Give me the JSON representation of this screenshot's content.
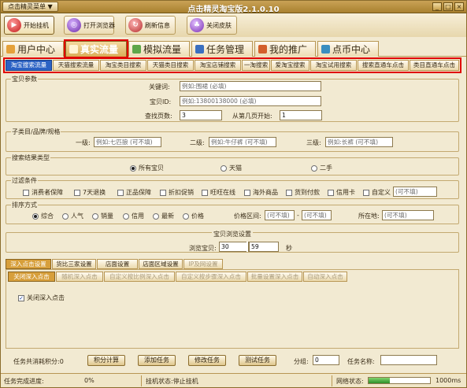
{
  "window": {
    "title": "点击精灵淘宝版2.1.0.10",
    "menu_label": "点击精灵菜单 ▼",
    "min_glyph": "_",
    "max_glyph": "□",
    "close_glyph": "×"
  },
  "toolbar": {
    "buttons": [
      {
        "label": "开始挂机"
      },
      {
        "label": "打开浏览器"
      },
      {
        "label": "刷新信息"
      },
      {
        "label": "关闭皮肤"
      }
    ]
  },
  "main_tabs": [
    {
      "label": "用户中心"
    },
    {
      "label": "真实流量"
    },
    {
      "label": "模拟流量"
    },
    {
      "label": "任务管理"
    },
    {
      "label": "我的推广"
    },
    {
      "label": "点币中心"
    }
  ],
  "sub_tabs": [
    {
      "label": "淘宝搜索流量"
    },
    {
      "label": "天猫搜索流量"
    },
    {
      "label": "淘宝类目搜索"
    },
    {
      "label": "天猫类目搜索"
    },
    {
      "label": "淘宝店铺搜索"
    },
    {
      "label": "一淘搜索"
    },
    {
      "label": "爱淘宝搜索"
    },
    {
      "label": "淘宝试用搜索"
    },
    {
      "label": "搜索直通车点击"
    },
    {
      "label": "类目直通车点击"
    }
  ],
  "basic": {
    "group_label": "宝贝参数",
    "keyword_label": "关键词:",
    "keyword_placeholder": "例如:围裙 (必填)",
    "itemid_label": "宝贝ID:",
    "itemid_placeholder": "例如:13800138000 (必填)",
    "pages_label": "查找页数:",
    "pages_value": "3",
    "start_label": "从第几页开始:",
    "start_value": "1"
  },
  "category": {
    "group_label": "子类目/品牌/规格",
    "level1_label": "一级:",
    "level1_placeholder": "例如:七匹狼 (可不填)",
    "level2_label": "二级:",
    "level2_placeholder": "例如:牛仔裤 (可不填)",
    "level3_label": "三级:",
    "level3_placeholder": "例如:长裤 (可不填)"
  },
  "result_type": {
    "group_label": "搜索结果类型",
    "options": [
      "所有宝贝",
      "天猫",
      "二手"
    ],
    "selected": "所有宝贝"
  },
  "filters": {
    "group_label": "过滤条件",
    "options": [
      "消费者保障",
      "7天退换",
      "正品保障",
      "折扣促销",
      "旺旺在线",
      "海外商品",
      "货到付款",
      "信用卡",
      "自定义"
    ],
    "custom_placeholder": "(可不填)"
  },
  "sort": {
    "group_label": "排序方式",
    "options": [
      "综合",
      "人气",
      "销量",
      "信用",
      "最新",
      "价格"
    ],
    "selected": "综合",
    "price_label": "价格区间:",
    "price_min_placeholder": "(可不填)",
    "price_dash": "-",
    "price_max_placeholder": "(可不填)",
    "location_label": "所在地:",
    "location_placeholder": "(可不填)"
  },
  "browse": {
    "group_label": "宝贝浏览设置",
    "duration_label": "浏览宝贝:",
    "duration_min": "30",
    "duration_dash": "-",
    "duration_max": "59",
    "duration_unit": "秒"
  },
  "click_tabs": [
    {
      "label": "深入点击设置"
    },
    {
      "label": "货比三家设置"
    },
    {
      "label": "店面设置"
    },
    {
      "label": "店面区域设置"
    },
    {
      "label": "IP及网设置"
    }
  ],
  "deep_tabs": [
    {
      "label": "关闭深入点击"
    },
    {
      "label": "随机深入点击"
    },
    {
      "label": "自定义按比例深入点击"
    },
    {
      "label": "自定义按步骤深入点击"
    },
    {
      "label": "批量设置深入点击"
    },
    {
      "label": "自动深入点击"
    }
  ],
  "deep_close_check": "关闭深入点击",
  "bottom": {
    "points_label": "任务共消耗积分:0",
    "calc_button": "积分计算",
    "add_button": "添加任务",
    "edit_button": "修改任务",
    "test_button": "测试任务",
    "group_label": "分组:",
    "group_value": "0",
    "name_label": "任务名称:"
  },
  "status": {
    "progress_label": "任务完成进度:",
    "progress_text": "0%",
    "machine_label": "挂机状态:停止挂机",
    "network_label": "网络状态:",
    "network_percent": 35,
    "latency": "1000ms"
  }
}
